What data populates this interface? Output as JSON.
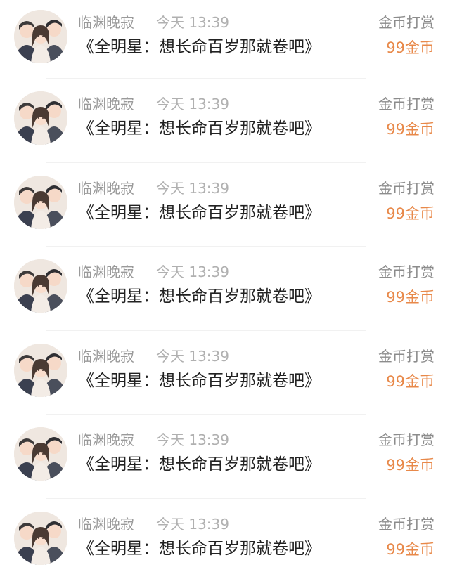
{
  "records": [
    {
      "user": "临渊晚寂",
      "time": "今天 13:39",
      "book": "《全明星：想长命百岁那就卷吧》",
      "action": "金币打赏",
      "amount": "99金币"
    },
    {
      "user": "临渊晚寂",
      "time": "今天 13:39",
      "book": "《全明星：想长命百岁那就卷吧》",
      "action": "金币打赏",
      "amount": "99金币"
    },
    {
      "user": "临渊晚寂",
      "time": "今天 13:39",
      "book": "《全明星：想长命百岁那就卷吧》",
      "action": "金币打赏",
      "amount": "99金币"
    },
    {
      "user": "临渊晚寂",
      "time": "今天 13:39",
      "book": "《全明星：想长命百岁那就卷吧》",
      "action": "金币打赏",
      "amount": "99金币"
    },
    {
      "user": "临渊晚寂",
      "time": "今天 13:39",
      "book": "《全明星：想长命百岁那就卷吧》",
      "action": "金币打赏",
      "amount": "99金币"
    },
    {
      "user": "临渊晚寂",
      "time": "今天 13:39",
      "book": "《全明星：想长命百岁那就卷吧》",
      "action": "金币打赏",
      "amount": "99金币"
    },
    {
      "user": "临渊晚寂",
      "time": "今天 13:39",
      "book": "《全明星：想长命百岁那就卷吧》",
      "action": "金币打赏",
      "amount": "99金币"
    }
  ],
  "colors": {
    "username": "#9a9a9a",
    "time": "#b0b0b0",
    "book_title": "#222222",
    "action": "#8c8c8c",
    "amount": "#e8894a",
    "divider": "#f1f1f1"
  },
  "icons": {
    "avatar": "three-characters-avatar-icon"
  }
}
